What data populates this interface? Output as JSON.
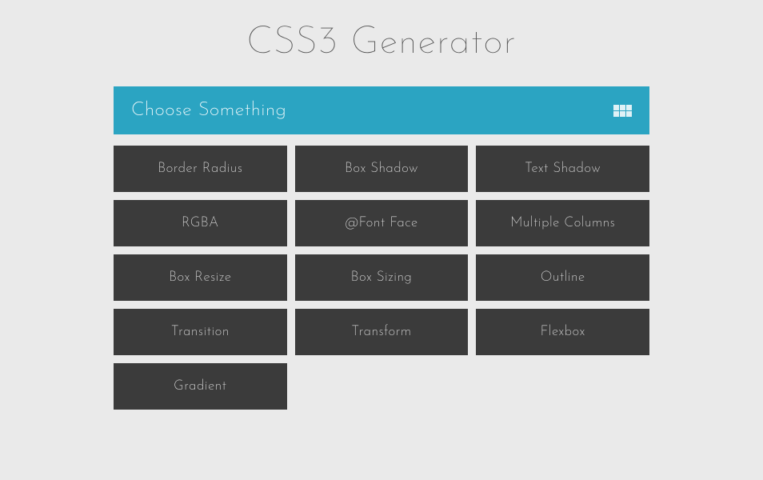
{
  "title": "CSS3 Generator",
  "header": {
    "label": "Choose Something"
  },
  "options": [
    "Border Radius",
    "Box Shadow",
    "Text Shadow",
    "RGBA",
    "@Font Face",
    "Multiple Columns",
    "Box Resize",
    "Box Sizing",
    "Outline",
    "Transition",
    "Transform",
    "Flexbox",
    "Gradient"
  ],
  "colors": {
    "accent": "#2ba4c2",
    "button_bg": "#3b3b3b",
    "page_bg": "#eaeaea",
    "title_color": "#545454"
  }
}
